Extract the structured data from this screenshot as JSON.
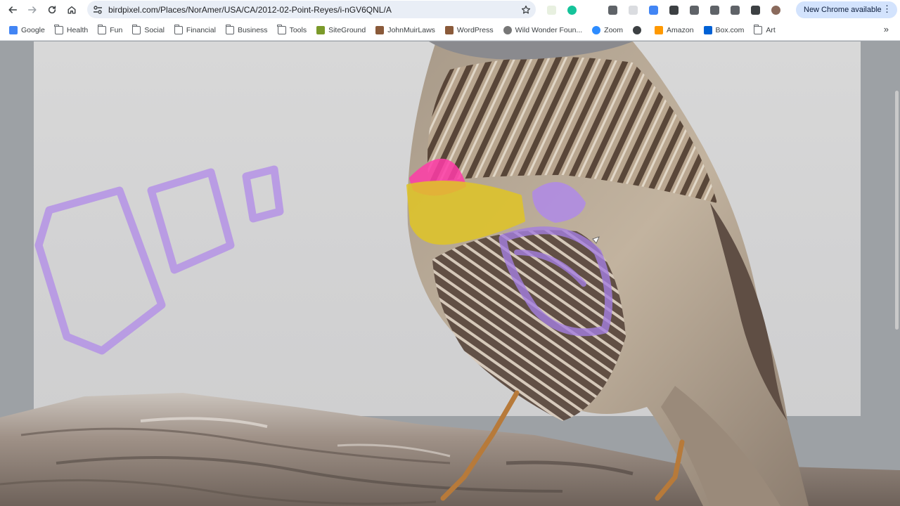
{
  "browser": {
    "url": "birdpixel.com/Places/NorAmer/USA/CA/2012-02-Point-Reyes/i-nGV6QNL/A",
    "update_label": "New Chrome available",
    "menu_glyph": "⋮"
  },
  "nav_icons": [
    "back-icon",
    "forward-icon",
    "reload-icon",
    "home-icon"
  ],
  "extensions": [
    {
      "name": "extension-1-icon",
      "color": "#e8f0e0"
    },
    {
      "name": "grammarly-icon",
      "color": "#15c39a"
    },
    {
      "name": "extension-s-icon",
      "color": "#ffffff"
    },
    {
      "name": "extension-f-icon",
      "color": "#5f6368"
    },
    {
      "name": "extension-gear-icon",
      "color": "#dadce0"
    },
    {
      "name": "extension-feather-icon",
      "color": "#4285f4"
    },
    {
      "name": "extension-box-icon",
      "color": "#3c4043"
    },
    {
      "name": "extension-qr-icon",
      "color": "#5f6368"
    },
    {
      "name": "extensions-puzzle-icon",
      "color": "#5f6368"
    },
    {
      "name": "download-icon",
      "color": "#5f6368"
    },
    {
      "name": "side-panel-icon",
      "color": "#3c4043"
    },
    {
      "name": "profile-avatar-icon",
      "color": "#8a6a5c"
    }
  ],
  "bookmarks": [
    {
      "label": "Google",
      "icon": "google-icon"
    },
    {
      "label": "Health",
      "icon": "folder-icon"
    },
    {
      "label": "Fun",
      "icon": "folder-icon"
    },
    {
      "label": "Social",
      "icon": "folder-icon"
    },
    {
      "label": "Financial",
      "icon": "folder-icon"
    },
    {
      "label": "Business",
      "icon": "folder-icon"
    },
    {
      "label": "Tools",
      "icon": "folder-icon"
    },
    {
      "label": "SiteGround",
      "icon": "siteground-icon"
    },
    {
      "label": "JohnMuirLaws",
      "icon": "johnmuirlaws-icon"
    },
    {
      "label": "WordPress",
      "icon": "wordpress-icon"
    },
    {
      "label": "Wild Wonder Foun...",
      "icon": "wild-wonder-icon"
    },
    {
      "label": "Zoom",
      "icon": "zoom-icon"
    },
    {
      "label": "",
      "icon": "globe-icon"
    },
    {
      "label": "Amazon",
      "icon": "amazon-icon"
    },
    {
      "label": "Box.com",
      "icon": "box-icon"
    },
    {
      "label": "Art",
      "icon": "folder-icon"
    }
  ],
  "bookmarks_more": "»",
  "colors": {
    "annotation_purple": "#b08ae8",
    "annotation_pink": "#ff3ca8",
    "annotation_yellow": "#e0c526"
  }
}
